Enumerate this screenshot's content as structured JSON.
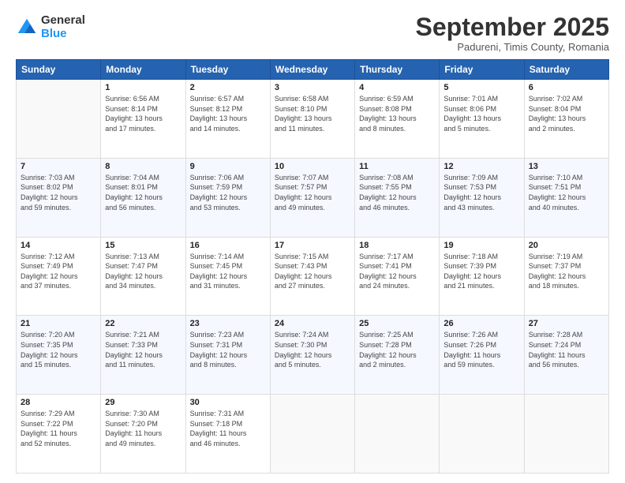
{
  "logo": {
    "general": "General",
    "blue": "Blue"
  },
  "header": {
    "month": "September 2025",
    "location": "Padureni, Timis County, Romania"
  },
  "weekdays": [
    "Sunday",
    "Monday",
    "Tuesday",
    "Wednesday",
    "Thursday",
    "Friday",
    "Saturday"
  ],
  "weeks": [
    [
      {
        "day": null,
        "info": null
      },
      {
        "day": "1",
        "info": "Sunrise: 6:56 AM\nSunset: 8:14 PM\nDaylight: 13 hours\nand 17 minutes."
      },
      {
        "day": "2",
        "info": "Sunrise: 6:57 AM\nSunset: 8:12 PM\nDaylight: 13 hours\nand 14 minutes."
      },
      {
        "day": "3",
        "info": "Sunrise: 6:58 AM\nSunset: 8:10 PM\nDaylight: 13 hours\nand 11 minutes."
      },
      {
        "day": "4",
        "info": "Sunrise: 6:59 AM\nSunset: 8:08 PM\nDaylight: 13 hours\nand 8 minutes."
      },
      {
        "day": "5",
        "info": "Sunrise: 7:01 AM\nSunset: 8:06 PM\nDaylight: 13 hours\nand 5 minutes."
      },
      {
        "day": "6",
        "info": "Sunrise: 7:02 AM\nSunset: 8:04 PM\nDaylight: 13 hours\nand 2 minutes."
      }
    ],
    [
      {
        "day": "7",
        "info": "Sunrise: 7:03 AM\nSunset: 8:02 PM\nDaylight: 12 hours\nand 59 minutes."
      },
      {
        "day": "8",
        "info": "Sunrise: 7:04 AM\nSunset: 8:01 PM\nDaylight: 12 hours\nand 56 minutes."
      },
      {
        "day": "9",
        "info": "Sunrise: 7:06 AM\nSunset: 7:59 PM\nDaylight: 12 hours\nand 53 minutes."
      },
      {
        "day": "10",
        "info": "Sunrise: 7:07 AM\nSunset: 7:57 PM\nDaylight: 12 hours\nand 49 minutes."
      },
      {
        "day": "11",
        "info": "Sunrise: 7:08 AM\nSunset: 7:55 PM\nDaylight: 12 hours\nand 46 minutes."
      },
      {
        "day": "12",
        "info": "Sunrise: 7:09 AM\nSunset: 7:53 PM\nDaylight: 12 hours\nand 43 minutes."
      },
      {
        "day": "13",
        "info": "Sunrise: 7:10 AM\nSunset: 7:51 PM\nDaylight: 12 hours\nand 40 minutes."
      }
    ],
    [
      {
        "day": "14",
        "info": "Sunrise: 7:12 AM\nSunset: 7:49 PM\nDaylight: 12 hours\nand 37 minutes."
      },
      {
        "day": "15",
        "info": "Sunrise: 7:13 AM\nSunset: 7:47 PM\nDaylight: 12 hours\nand 34 minutes."
      },
      {
        "day": "16",
        "info": "Sunrise: 7:14 AM\nSunset: 7:45 PM\nDaylight: 12 hours\nand 31 minutes."
      },
      {
        "day": "17",
        "info": "Sunrise: 7:15 AM\nSunset: 7:43 PM\nDaylight: 12 hours\nand 27 minutes."
      },
      {
        "day": "18",
        "info": "Sunrise: 7:17 AM\nSunset: 7:41 PM\nDaylight: 12 hours\nand 24 minutes."
      },
      {
        "day": "19",
        "info": "Sunrise: 7:18 AM\nSunset: 7:39 PM\nDaylight: 12 hours\nand 21 minutes."
      },
      {
        "day": "20",
        "info": "Sunrise: 7:19 AM\nSunset: 7:37 PM\nDaylight: 12 hours\nand 18 minutes."
      }
    ],
    [
      {
        "day": "21",
        "info": "Sunrise: 7:20 AM\nSunset: 7:35 PM\nDaylight: 12 hours\nand 15 minutes."
      },
      {
        "day": "22",
        "info": "Sunrise: 7:21 AM\nSunset: 7:33 PM\nDaylight: 12 hours\nand 11 minutes."
      },
      {
        "day": "23",
        "info": "Sunrise: 7:23 AM\nSunset: 7:31 PM\nDaylight: 12 hours\nand 8 minutes."
      },
      {
        "day": "24",
        "info": "Sunrise: 7:24 AM\nSunset: 7:30 PM\nDaylight: 12 hours\nand 5 minutes."
      },
      {
        "day": "25",
        "info": "Sunrise: 7:25 AM\nSunset: 7:28 PM\nDaylight: 12 hours\nand 2 minutes."
      },
      {
        "day": "26",
        "info": "Sunrise: 7:26 AM\nSunset: 7:26 PM\nDaylight: 11 hours\nand 59 minutes."
      },
      {
        "day": "27",
        "info": "Sunrise: 7:28 AM\nSunset: 7:24 PM\nDaylight: 11 hours\nand 56 minutes."
      }
    ],
    [
      {
        "day": "28",
        "info": "Sunrise: 7:29 AM\nSunset: 7:22 PM\nDaylight: 11 hours\nand 52 minutes."
      },
      {
        "day": "29",
        "info": "Sunrise: 7:30 AM\nSunset: 7:20 PM\nDaylight: 11 hours\nand 49 minutes."
      },
      {
        "day": "30",
        "info": "Sunrise: 7:31 AM\nSunset: 7:18 PM\nDaylight: 11 hours\nand 46 minutes."
      },
      {
        "day": null,
        "info": null
      },
      {
        "day": null,
        "info": null
      },
      {
        "day": null,
        "info": null
      },
      {
        "day": null,
        "info": null
      }
    ]
  ]
}
